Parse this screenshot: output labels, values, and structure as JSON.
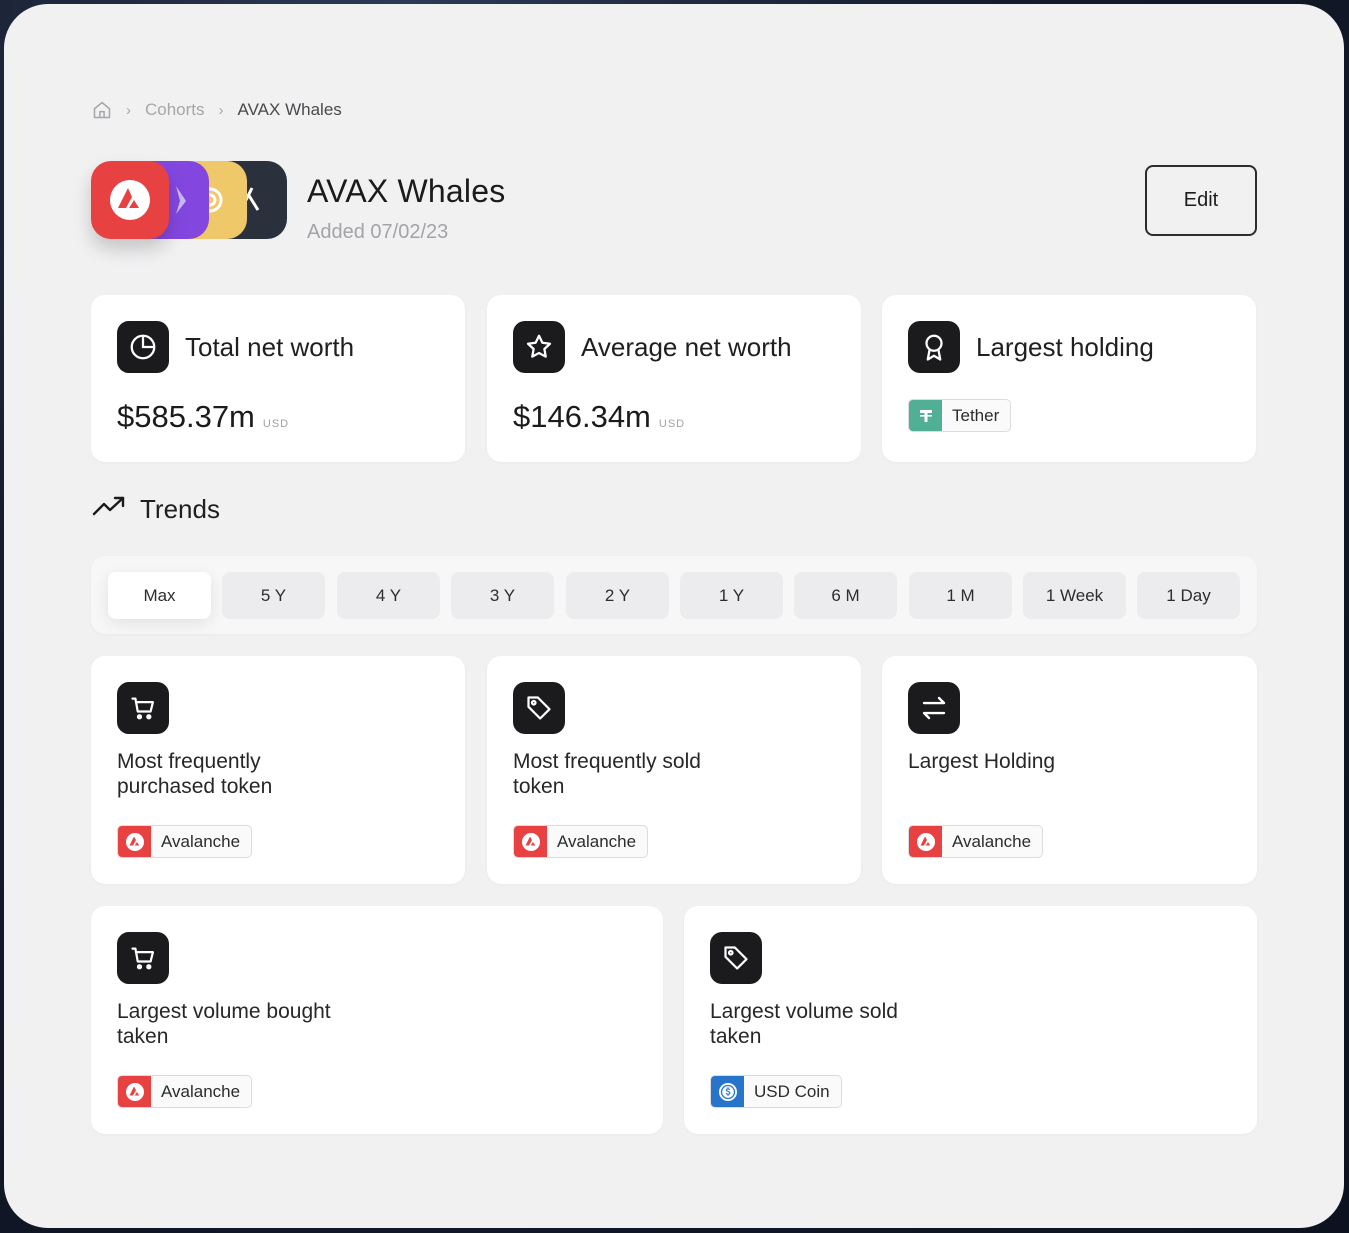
{
  "breadcrumb": {
    "home_icon": "home-icon",
    "cohorts": "Cohorts",
    "current": "AVAX Whales"
  },
  "cohort": {
    "title": "AVAX Whales",
    "added": "Added 07/02/23",
    "edit_label": "Edit"
  },
  "stats": [
    {
      "title": "Total net worth",
      "icon": "pie-chart-icon",
      "value": "$585.37m",
      "unit": "USD"
    },
    {
      "title": "Average net worth",
      "icon": "star-icon",
      "value": "$146.34m",
      "unit": "USD"
    },
    {
      "title": "Largest holding",
      "icon": "award-icon",
      "token": "Tether"
    }
  ],
  "trends": {
    "heading": "Trends",
    "ranges": [
      "Max",
      "5 Y",
      "4 Y",
      "3 Y",
      "2 Y",
      "1 Y",
      "6 M",
      "1 M",
      "1 Week",
      "1 Day"
    ],
    "selected_range": "Max",
    "cards": [
      {
        "label": "Most frequently purchased token",
        "icon": "cart-icon",
        "token": "Avalanche"
      },
      {
        "label": "Most frequently sold token",
        "icon": "tag-icon",
        "token": "Avalanche"
      },
      {
        "label": "Largest Holding",
        "icon": "swap-icon",
        "token": "Avalanche"
      },
      {
        "label": "Largest volume bought taken",
        "icon": "cart-icon",
        "token": "Avalanche"
      },
      {
        "label": "Largest volume sold taken",
        "icon": "tag-icon",
        "token": "USD Coin"
      }
    ]
  },
  "colors": {
    "avalanche": "#e84142",
    "tether": "#50af95",
    "usdc": "#2775ca",
    "dark": "#1b1b1d"
  }
}
